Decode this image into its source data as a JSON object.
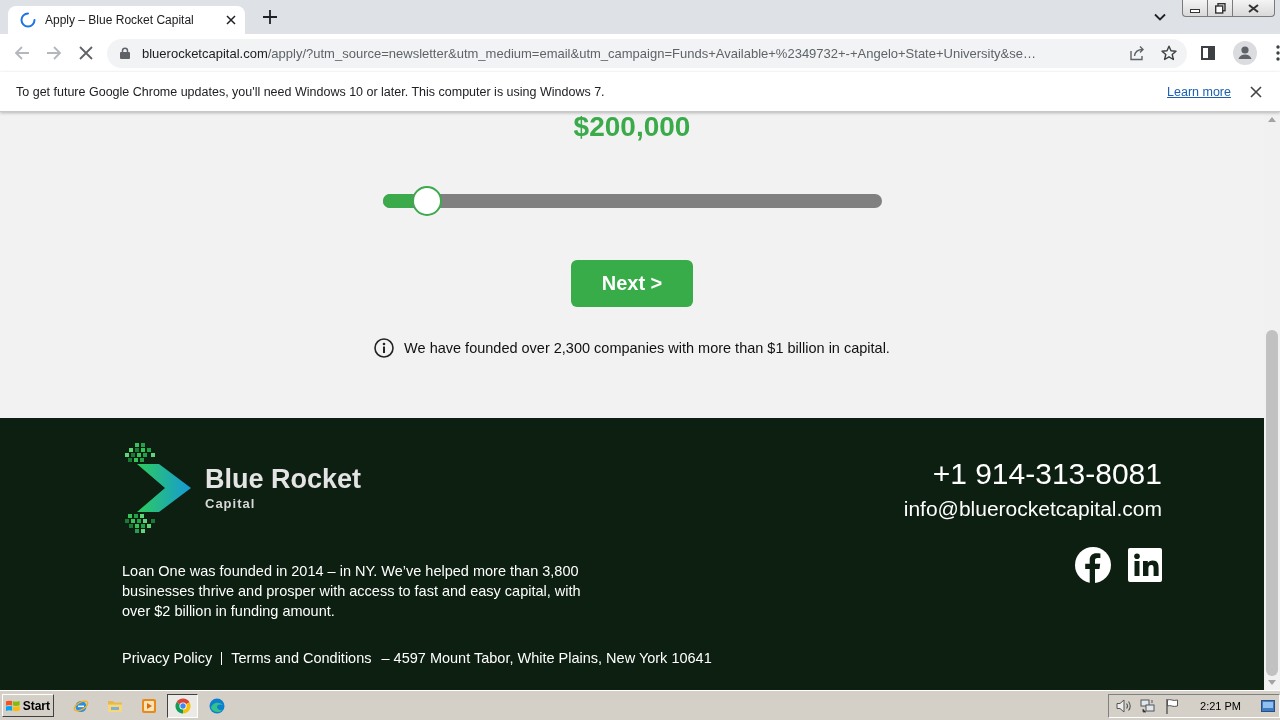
{
  "browser": {
    "tabs": [
      {
        "title": "Apply – Blue Rocket Capital",
        "selected": true,
        "loading": true
      }
    ],
    "nav": [
      {
        "kind": "back",
        "disabled": true
      },
      {
        "kind": "forward",
        "disabled": true
      },
      {
        "kind": "stop",
        "disabled": false
      }
    ],
    "address_bar": {
      "host": "bluerocketcapital.com",
      "path": "/apply/?utm_source=newsletter&utm_medium=email&utm_campaign=Funds+Available+%2349732+-+Angelo+State+University&se…"
    },
    "info_bar": {
      "message": "To get future Google Chrome updates, you'll need Windows 10 or later. This computer is using Windows 7.",
      "link": "Learn more"
    }
  },
  "page": {
    "amount": "$200,000",
    "slider": {
      "level": 0.09
    },
    "next_button": "Next >",
    "info_text": "We have founded over 2,300 companies with more than $1 billion in capital."
  },
  "footer": {
    "brand": {
      "name": "Blue Rocket",
      "tagline": "Capital"
    },
    "about": "Loan One was founded in 2014 – in NY. We’ve helped more than 3,800 businesses thrive and prosper with access to fast and easy capital, with over $2 billion in funding amount.",
    "links": [
      "Privacy Policy",
      "Terms and Conditions"
    ],
    "address": "– 4597 Mount Tabor, White Plains, New York 10641",
    "phone": "+1 914-313-8081",
    "email": "info@bluerocketcapital.com",
    "social": [
      {
        "kind": "facebook"
      },
      {
        "kind": "linkedin"
      }
    ]
  },
  "taskbar": {
    "start": "Start",
    "apps": [
      {
        "kind": "internet-explorer",
        "selected": false
      },
      {
        "kind": "folder",
        "selected": false
      },
      {
        "kind": "media-player",
        "selected": false
      },
      {
        "kind": "chrome",
        "selected": true
      },
      {
        "kind": "edge",
        "selected": false
      }
    ],
    "clock": "2:21 PM"
  }
}
